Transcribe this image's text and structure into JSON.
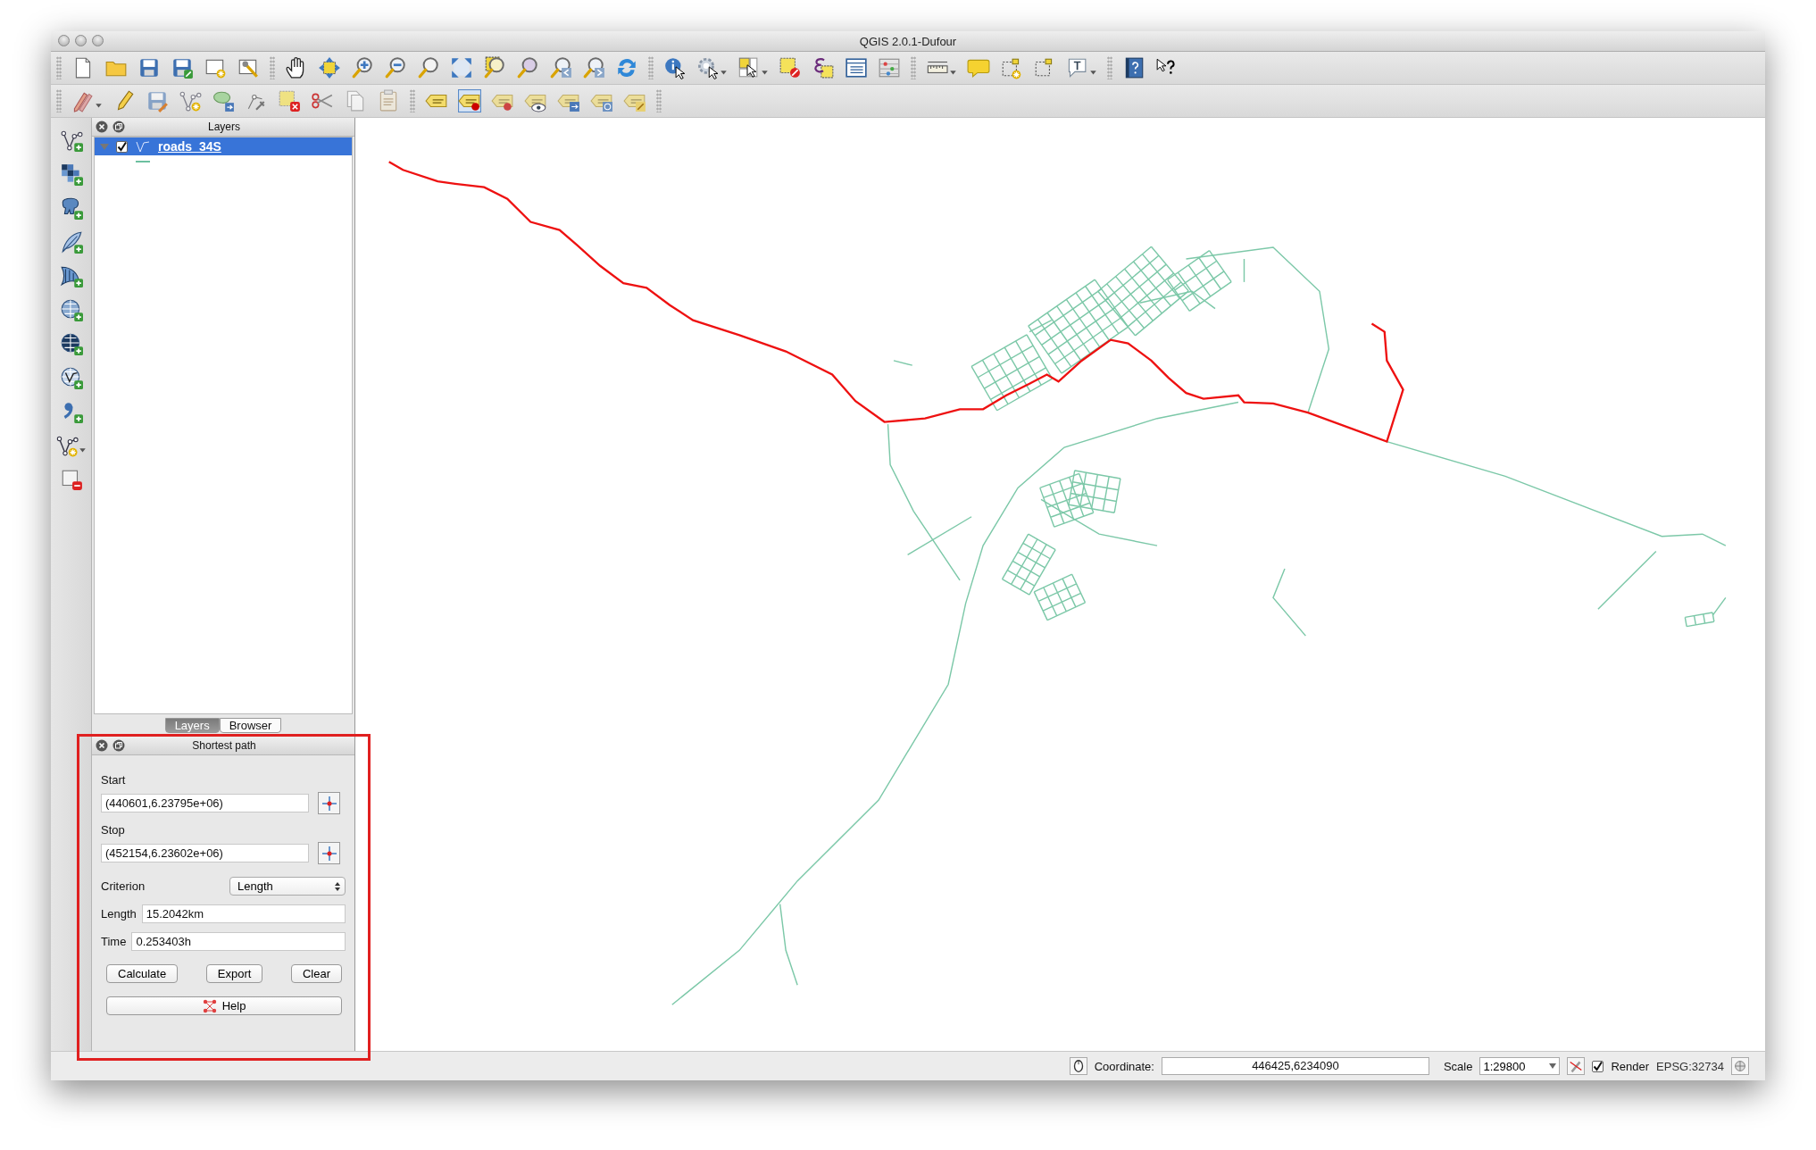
{
  "window": {
    "title": "QGIS 2.0.1-Dufour"
  },
  "layers_panel": {
    "title": "Layers",
    "layers": [
      {
        "name": "roads_34S",
        "checked": true,
        "expanded": true,
        "selected": true
      }
    ]
  },
  "dock_tabs": [
    {
      "label": "Layers",
      "selected": true
    },
    {
      "label": "Browser",
      "selected": false
    }
  ],
  "shortest_path": {
    "title": "Shortest path",
    "start_label": "Start",
    "start_value": "(440601,6.23795e+06)",
    "stop_label": "Stop",
    "stop_value": "(452154,6.23602e+06)",
    "criterion_label": "Criterion",
    "criterion_value": "Length",
    "length_label": "Length",
    "length_value": "15.2042km",
    "time_label": "Time",
    "time_value": "0.253403h",
    "buttons": [
      "Calculate",
      "Export",
      "Clear"
    ],
    "help_button": "Help"
  },
  "status_bar": {
    "coordinate_label": "Coordinate:",
    "coordinate_value": "446425,6234090",
    "scale_label": "Scale",
    "scale_value": "1:29800",
    "render": {
      "label": "Render",
      "checked": true
    },
    "crs": "EPSG:32734"
  }
}
